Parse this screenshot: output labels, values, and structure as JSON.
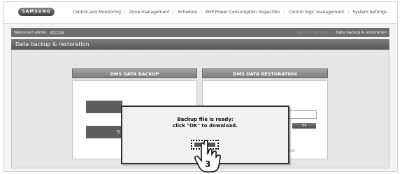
{
  "brand": {
    "logo_text": "SAMSUNG"
  },
  "nav": {
    "items": [
      {
        "label": "Control and Monitoring"
      },
      {
        "label": "Zone management"
      },
      {
        "label": "Schedule"
      },
      {
        "label": "EHP Power Consumption Inspection"
      },
      {
        "label": "Control logic management"
      },
      {
        "label": "System Settings"
      }
    ]
  },
  "header": {
    "welcome": "Welcome! admin,",
    "badge": "SUBMIT",
    "breadcrumb": {
      "parent": "System Settings",
      "current": "Data backup & restoration"
    }
  },
  "page": {
    "title": "Data backup & restoration"
  },
  "backup": {
    "title": "DMS DATA BACKUP",
    "button_partial_char": "S"
  },
  "restoration": {
    "title": "DMS DATA RESTORATION",
    "ok_label": "Ok",
    "hint_text": "ord."
  },
  "dialog": {
    "line1": "Backup file is ready:",
    "line2": "click \"OK\" to download."
  },
  "annotation": {
    "step_number": "3"
  }
}
